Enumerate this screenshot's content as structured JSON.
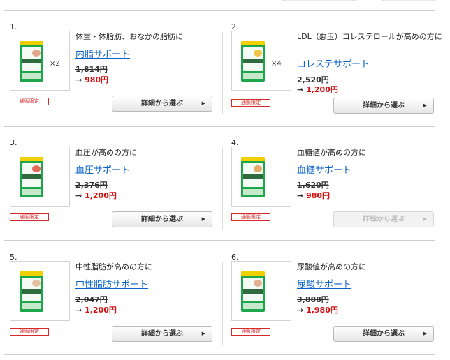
{
  "products": [
    {
      "num": "1.",
      "desc": "体重・体脂肪、おなかの脂肪に",
      "name": "内脂サポート",
      "mult": "×2",
      "old_price": "1,814円",
      "arrow": "→",
      "new_price": "980円",
      "tag": "通販限定",
      "button": "詳細から選ぶ",
      "button_arrow": "▶",
      "disabled": false,
      "pkg_color": "#1ea64a",
      "blob_color": "#e8a38c"
    },
    {
      "num": "2.",
      "desc": "LDL（悪玉）コレステロールが高めの方に",
      "name": "コレステサポート",
      "mult": "×4",
      "old_price": "2,520円",
      "arrow": "→",
      "new_price": "1,200円",
      "tag": "通販限定",
      "button": "詳細から選ぶ",
      "button_arrow": "▶",
      "disabled": false,
      "pkg_color": "#1ea64a",
      "blob_color": "#f0c64a"
    },
    {
      "num": "3.",
      "desc": "血圧が高めの方に",
      "name": "血圧サポート",
      "mult": "",
      "old_price": "2,376円",
      "arrow": "→",
      "new_price": "1,200円",
      "tag": "通販限定",
      "button": "詳細から選ぶ",
      "button_arrow": "▶",
      "disabled": false,
      "pkg_color": "#1ea64a",
      "blob_color": "#e86a5a"
    },
    {
      "num": "4.",
      "desc": "血糖値が高めの方に",
      "name": "血糖サポート",
      "mult": "",
      "old_price": "1,620円",
      "arrow": "→",
      "new_price": "980円",
      "tag": "通販限定",
      "button": "詳細から選ぶ",
      "button_arrow": "▶",
      "disabled": true,
      "pkg_color": "#1ea64a",
      "blob_color": "#e7a868"
    },
    {
      "num": "5.",
      "desc": "中性脂肪が高めの方に",
      "name": "中性脂肪サポート",
      "mult": "",
      "old_price": "2,047円",
      "arrow": "→",
      "new_price": "1,200円",
      "tag": "通販限定",
      "button": "詳細から選ぶ",
      "button_arrow": "▶",
      "disabled": false,
      "pkg_color": "#1ea64a",
      "blob_color": "#e8c0a0"
    },
    {
      "num": "6.",
      "desc": "尿酸値が高めの方に",
      "name": "尿酸サポート",
      "mult": "",
      "old_price": "3,888円",
      "arrow": "→",
      "new_price": "1,980円",
      "tag": "通販限定",
      "button": "詳細から選ぶ",
      "button_arrow": "▶",
      "disabled": false,
      "pkg_color": "#1ea64a",
      "blob_color": "#e0b090"
    }
  ]
}
